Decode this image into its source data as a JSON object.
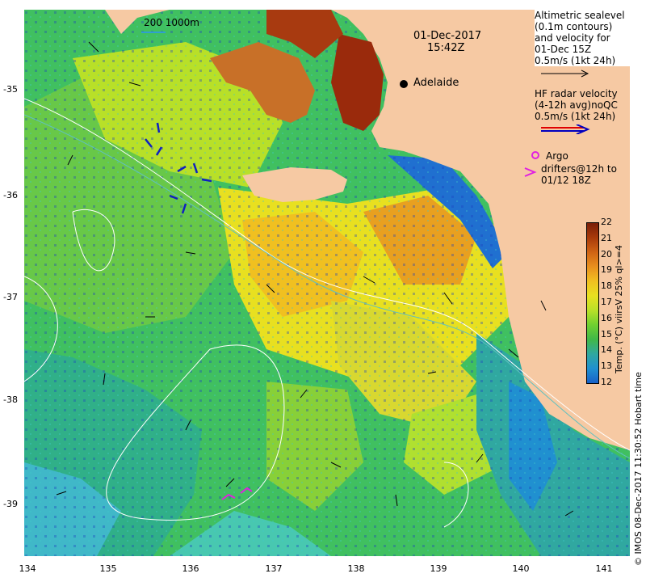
{
  "map": {
    "date": "01-Dec-2017",
    "time": "15:42Z",
    "scale_label": "200  1000m",
    "city": "Adelaide",
    "lat_ticks": [
      "-35",
      "-36",
      "-37",
      "-38",
      "-39"
    ],
    "lon_ticks": [
      "134",
      "135",
      "136",
      "137",
      "138",
      "139",
      "140",
      "141"
    ]
  },
  "legend": {
    "altimetry": [
      "Altimetric sealevel",
      "(0.1m contours)",
      "and velocity for",
      "01-Dec 15Z",
      "0.5m/s (1kt 24h)"
    ],
    "hf_radar": [
      "HF radar velocity",
      "(4-12h avg)noQC",
      "0.5m/s (1kt 24h)"
    ],
    "argo": "Argo",
    "drifters": [
      "drifters@12h to",
      "01/12 18Z"
    ]
  },
  "colorbar": {
    "title": "Temp. (°C) viirsV 25% ql>=4",
    "ticks": [
      "22",
      "21",
      "20",
      "19",
      "18",
      "17",
      "16",
      "15",
      "14",
      "13",
      "12"
    ],
    "colors": [
      "#7a1e08",
      "#a83a0a",
      "#d06414",
      "#e8901e",
      "#f0c020",
      "#e8e020",
      "#b8e028",
      "#70d030",
      "#40b848",
      "#30a8a0",
      "#2090d0",
      "#1860c8"
    ]
  },
  "credit": "© IMOS 08-Dec-2017 11:30:52 Hobart time",
  "colors": {
    "land": "#f6c9a3",
    "drifter": "#e020e0",
    "hf_radar_red": "#e00000",
    "hf_radar_blue": "#0000c0"
  }
}
